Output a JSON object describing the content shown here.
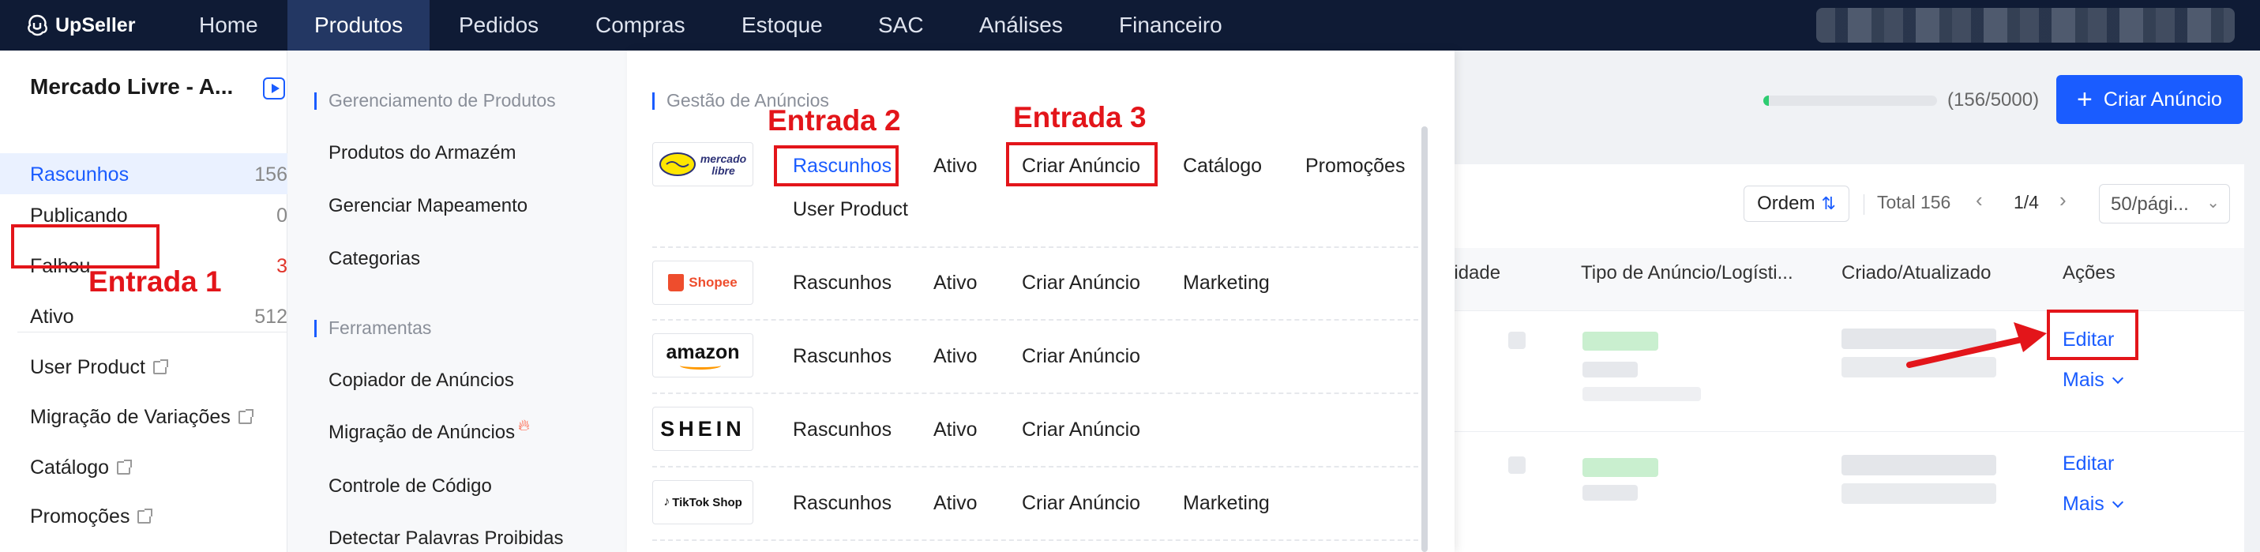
{
  "app": {
    "name": "UpSeller"
  },
  "nav": {
    "items": [
      {
        "label": "Home"
      },
      {
        "label": "Produtos"
      },
      {
        "label": "Pedidos"
      },
      {
        "label": "Compras"
      },
      {
        "label": "Estoque"
      },
      {
        "label": "SAC"
      },
      {
        "label": "Análises"
      },
      {
        "label": "Financeiro"
      }
    ],
    "active": "Produtos"
  },
  "sidebar": {
    "shop_title": "Mercado Livre - A...",
    "statuses": [
      {
        "label": "Rascunhos",
        "count": "156"
      },
      {
        "label": "Publicando",
        "count": "0"
      },
      {
        "label": "Falhou",
        "count": "3"
      },
      {
        "label": "Ativo",
        "count": "512"
      }
    ],
    "links": [
      {
        "label": "User Product"
      },
      {
        "label": "Migração de Variações"
      },
      {
        "label": "Catálogo"
      },
      {
        "label": "Promoções"
      }
    ]
  },
  "mega_menu": {
    "gerenciamento_title": "Gerenciamento de Produtos",
    "gerenciamento_items": [
      "Produtos do Armazém",
      "Gerenciar Mapeamento",
      "Categorias"
    ],
    "ferramentas_title": "Ferramentas",
    "ferramentas_items": [
      "Copiador de Anúncios",
      "Migração de Anúncios",
      "Controle de Código",
      "Detectar Palavras Proibidas"
    ],
    "gestao_title": "Gestão de Anúncios",
    "marketplaces": [
      {
        "brand": "mercado libre",
        "options": [
          "Rascunhos",
          "Ativo",
          "Criar Anúncio",
          "Catálogo",
          "Promoções",
          "User Product"
        ]
      },
      {
        "brand": "Shopee",
        "options": [
          "Rascunhos",
          "Ativo",
          "Criar Anúncio",
          "Marketing"
        ]
      },
      {
        "brand": "amazon",
        "options": [
          "Rascunhos",
          "Ativo",
          "Criar Anúncio"
        ]
      },
      {
        "brand": "SHEIN",
        "options": [
          "Rascunhos",
          "Ativo",
          "Criar Anúncio"
        ]
      },
      {
        "brand": "TikTok Shop",
        "options": [
          "Rascunhos",
          "Ativo",
          "Criar Anúncio",
          "Marketing"
        ]
      }
    ]
  },
  "annotations": {
    "entrada1": "Entrada 1",
    "entrada2": "Entrada 2",
    "entrada3": "Entrada 3"
  },
  "toolbar": {
    "progress_text": "(156/5000)",
    "progress_fraction": 0.0312,
    "create_label": "Criar Anúncio",
    "ordem_label": "Ordem",
    "total_text": "Total 156",
    "page_text": "1/4",
    "per_page": "50/pági..."
  },
  "table": {
    "headers": [
      "antidade",
      "Tipo de Anúncio/Logísti...",
      "Criado/Atualizado",
      "Ações"
    ],
    "rows": [
      {
        "edit": "Editar",
        "more": "Mais"
      },
      {
        "edit": "Editar",
        "more": "Mais"
      }
    ]
  },
  "colors": {
    "nav_bg": "#0f1b35",
    "accent": "#1a5cff",
    "annotation_red": "#e3151a"
  }
}
